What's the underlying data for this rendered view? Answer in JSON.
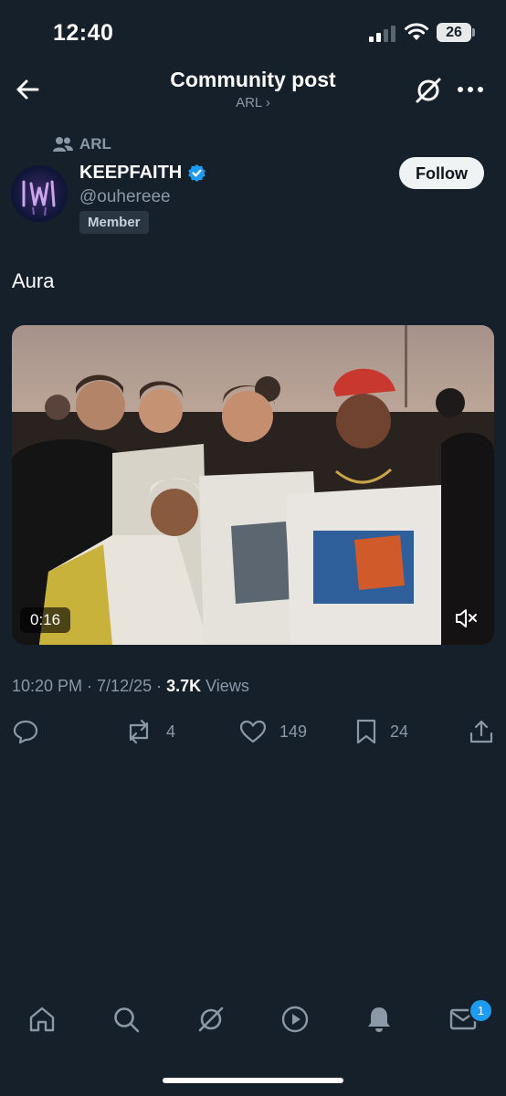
{
  "status_bar": {
    "time": "12:40",
    "battery": "26"
  },
  "header": {
    "title": "Community post",
    "subtitle": "ARL ›"
  },
  "post": {
    "community": "ARL",
    "display_name": "KEEPFAITH",
    "handle": "@ouhereee",
    "badge": "Member",
    "follow_label": "Follow",
    "text": "Aura",
    "video_duration": "0:16",
    "timestamp": "10:20 PM · 7/12/25 · ",
    "views_count": "3.7K",
    "views_label": " Views"
  },
  "actions": {
    "reposts": "4",
    "likes": "149",
    "bookmarks": "24"
  },
  "nav": {
    "messages_badge": "1"
  },
  "colors": {
    "background": "#15202b",
    "secondary_text": "#8b98a5",
    "accent": "#1d9bf0"
  }
}
